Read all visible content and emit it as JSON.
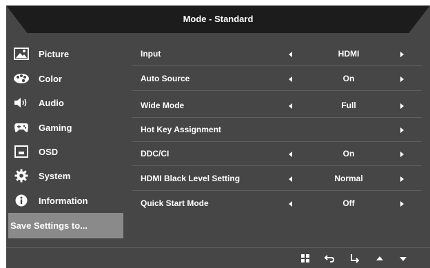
{
  "osd": {
    "title": "Mode - Standard"
  },
  "sidebar": {
    "items": [
      {
        "label": "Picture",
        "icon": "picture-icon"
      },
      {
        "label": "Color",
        "icon": "palette-icon"
      },
      {
        "label": "Audio",
        "icon": "speaker-icon"
      },
      {
        "label": "Gaming",
        "icon": "gamepad-icon"
      },
      {
        "label": "OSD",
        "icon": "monitor-icon"
      },
      {
        "label": "System",
        "icon": "gear-icon"
      },
      {
        "label": "Information",
        "icon": "info-icon"
      },
      {
        "label": "Save Settings to..."
      }
    ],
    "active_index": 7
  },
  "settings": [
    {
      "label": "Input",
      "value": "HDMI"
    },
    {
      "label": "Auto Source",
      "value": "On"
    },
    {
      "label": "Wide Mode",
      "value": "Full"
    },
    {
      "label": "Hot Key Assignment",
      "value": ""
    },
    {
      "label": "DDC/CI",
      "value": "On"
    },
    {
      "label": "HDMI Black Level Setting",
      "value": "Normal"
    },
    {
      "label": "Quick Start Mode",
      "value": "Off"
    }
  ],
  "footer": {
    "icons": [
      "menu-grid-icon",
      "back-icon",
      "enter-icon",
      "up-icon",
      "down-icon"
    ]
  },
  "colors": {
    "panel_bg": "#464646",
    "title_bg": "#1c1c1c",
    "active_item_bg": "#8a8a8a",
    "text": "#ffffff"
  }
}
